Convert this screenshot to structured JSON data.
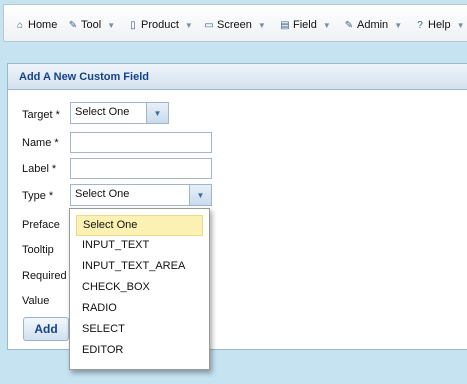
{
  "menu": {
    "items": [
      {
        "label": "Home",
        "icon": "home-icon",
        "glyph": "⌂",
        "dropdown": false
      },
      {
        "label": "Tool",
        "icon": "tool-icon",
        "glyph": "✎",
        "dropdown": true
      },
      {
        "label": "Product",
        "icon": "document-icon",
        "glyph": "▯",
        "dropdown": true
      },
      {
        "label": "Screen",
        "icon": "screen-icon",
        "glyph": "▭",
        "dropdown": true
      },
      {
        "label": "Field",
        "icon": "field-icon",
        "glyph": "▤",
        "dropdown": true
      },
      {
        "label": "Admin",
        "icon": "admin-icon",
        "glyph": "✎",
        "dropdown": true
      },
      {
        "label": "Help",
        "icon": "help-icon",
        "glyph": "?",
        "dropdown": true
      }
    ]
  },
  "panel": {
    "title": "Add A New Custom Field"
  },
  "form": {
    "target_label": "Target",
    "target_value": "Select One",
    "name_label": "Name",
    "name_value": "",
    "label_label": "Label",
    "label_value": "",
    "type_label": "Type",
    "type_value": "Select One",
    "preface_label": "Preface",
    "tooltip_label": "Tooltip",
    "required_label": "Required",
    "value_label": "Value",
    "required_marker": "*",
    "add_label": "Add"
  },
  "type_dropdown": {
    "options": [
      "Select One",
      "INPUT_TEXT",
      "INPUT_TEXT_AREA",
      "CHECK_BOX",
      "RADIO",
      "SELECT",
      "EDITOR"
    ],
    "selected": "Select One"
  },
  "colors": {
    "background": "#c5e3f1",
    "header_text": "#15428b",
    "selected_option": "#fbf1b2"
  }
}
